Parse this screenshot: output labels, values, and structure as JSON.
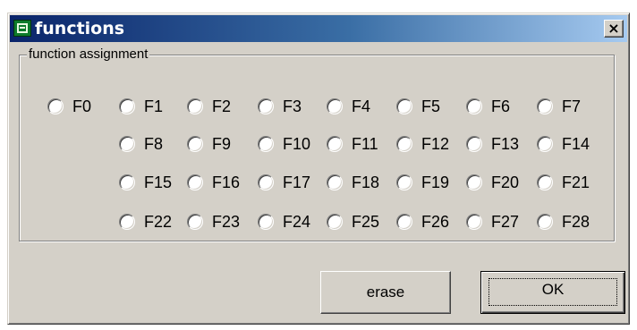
{
  "window": {
    "title": "functions",
    "close_label": "×"
  },
  "group": {
    "label": "function assignment"
  },
  "functions": [
    "F0",
    "F1",
    "F2",
    "F3",
    "F4",
    "F5",
    "F6",
    "F7",
    "F8",
    "F9",
    "F10",
    "F11",
    "F12",
    "F13",
    "F14",
    "F15",
    "F16",
    "F17",
    "F18",
    "F19",
    "F20",
    "F21",
    "F22",
    "F23",
    "F24",
    "F25",
    "F26",
    "F27",
    "F28"
  ],
  "buttons": {
    "erase_label": "erase",
    "ok_label": "OK"
  },
  "colors": {
    "title_start": "#0a246a",
    "title_end": "#a6caf0",
    "face": "#d4d0c8",
    "icon_green": "#0d7a2a"
  }
}
